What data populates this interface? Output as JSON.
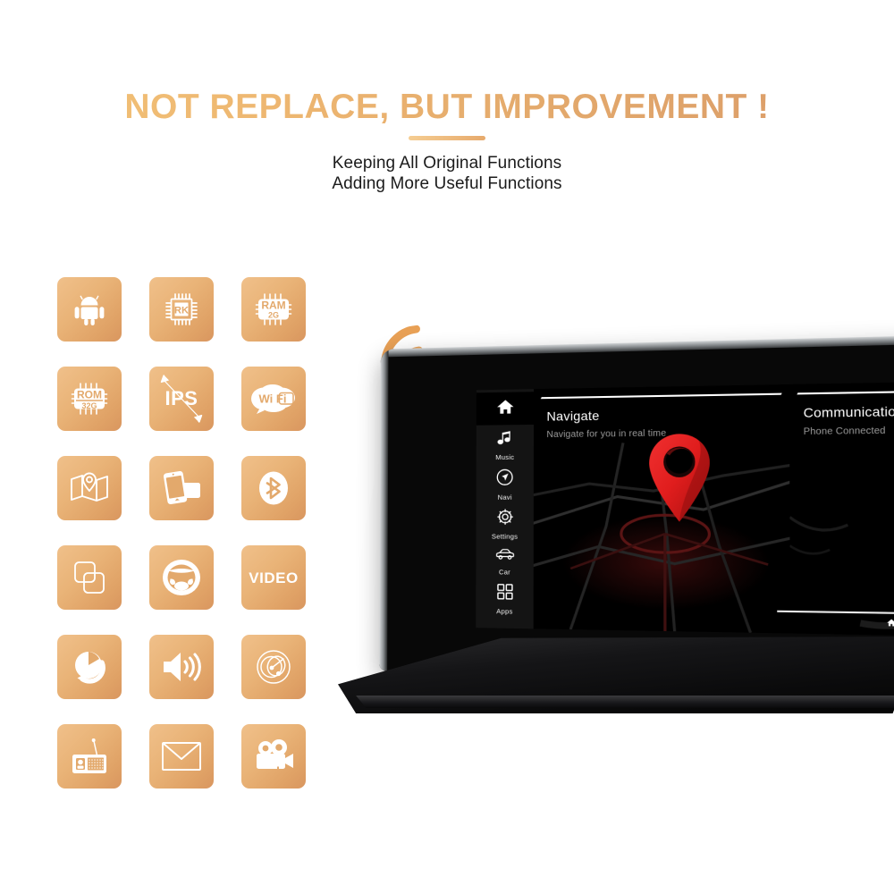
{
  "header": {
    "headline": "NOT REPLACE, BUT IMPROVEMENT !",
    "subline_1": "Keeping All Original Functions",
    "subline_2": "Adding More Useful Functions",
    "accent_color": "#e8ab6c"
  },
  "features": {
    "tiles": [
      {
        "id": "android",
        "icon": "android-robot-icon",
        "label": ""
      },
      {
        "id": "cpu",
        "icon": "cpu-chip-icon",
        "label": "RK"
      },
      {
        "id": "ram",
        "icon": "ram-chip-icon",
        "label": "RAM",
        "sub": "2G"
      },
      {
        "id": "rom",
        "icon": "rom-chip-icon",
        "label": "ROM",
        "sub": "32G"
      },
      {
        "id": "ips",
        "icon": "ips-display-icon",
        "label": "IPS"
      },
      {
        "id": "wifi",
        "icon": "wifi-cloud-icon",
        "label": "Wi Fi"
      },
      {
        "id": "gps-map",
        "icon": "map-pin-icon",
        "label": ""
      },
      {
        "id": "mirror-link",
        "icon": "phone-mirror-icon",
        "label": ""
      },
      {
        "id": "bluetooth",
        "icon": "bluetooth-icon",
        "label": ""
      },
      {
        "id": "split-screen",
        "icon": "split-screen-icon",
        "label": ""
      },
      {
        "id": "steering",
        "icon": "steering-wheel-icon",
        "label": ""
      },
      {
        "id": "video",
        "icon": "video-text-icon",
        "label": "VIDEO"
      },
      {
        "id": "sync-update",
        "icon": "sync-refresh-icon",
        "label": ""
      },
      {
        "id": "audio",
        "icon": "speaker-volume-icon",
        "label": ""
      },
      {
        "id": "radar",
        "icon": "radar-tracking-icon",
        "label": ""
      },
      {
        "id": "radio",
        "icon": "radio-receiver-icon",
        "label": ""
      },
      {
        "id": "mail",
        "icon": "mail-envelope-icon",
        "label": ""
      },
      {
        "id": "camera",
        "icon": "video-camera-icon",
        "label": ""
      }
    ],
    "tile_gradient_from": "#f0c08a",
    "tile_gradient_to": "#d9965f"
  },
  "device": {
    "wifi_indicator": "wifi-signal-icon",
    "screen": {
      "sidebar": {
        "home": {
          "icon": "home-icon",
          "label": ""
        },
        "items": [
          {
            "icon": "music-note-icon",
            "label": "Music"
          },
          {
            "icon": "navi-compass-icon",
            "label": "Navi"
          },
          {
            "icon": "gear-icon",
            "label": "Settings"
          },
          {
            "icon": "car-icon",
            "label": "Car"
          },
          {
            "icon": "apps-grid-icon",
            "label": "Apps"
          }
        ]
      },
      "cards": [
        {
          "id": "navigate",
          "title": "Navigate",
          "subtitle": "Navigate for you in real time",
          "art": "map-pin-art",
          "pin_color": "#e02020"
        },
        {
          "id": "communication",
          "title": "Communication",
          "subtitle": "Phone Connected",
          "art": "signal-arcs-art",
          "accent_color": "#8a1010"
        }
      ],
      "bottom_bar": {
        "home_icon": "home-icon",
        "dots": 2,
        "active_dot_index": 0
      }
    }
  }
}
